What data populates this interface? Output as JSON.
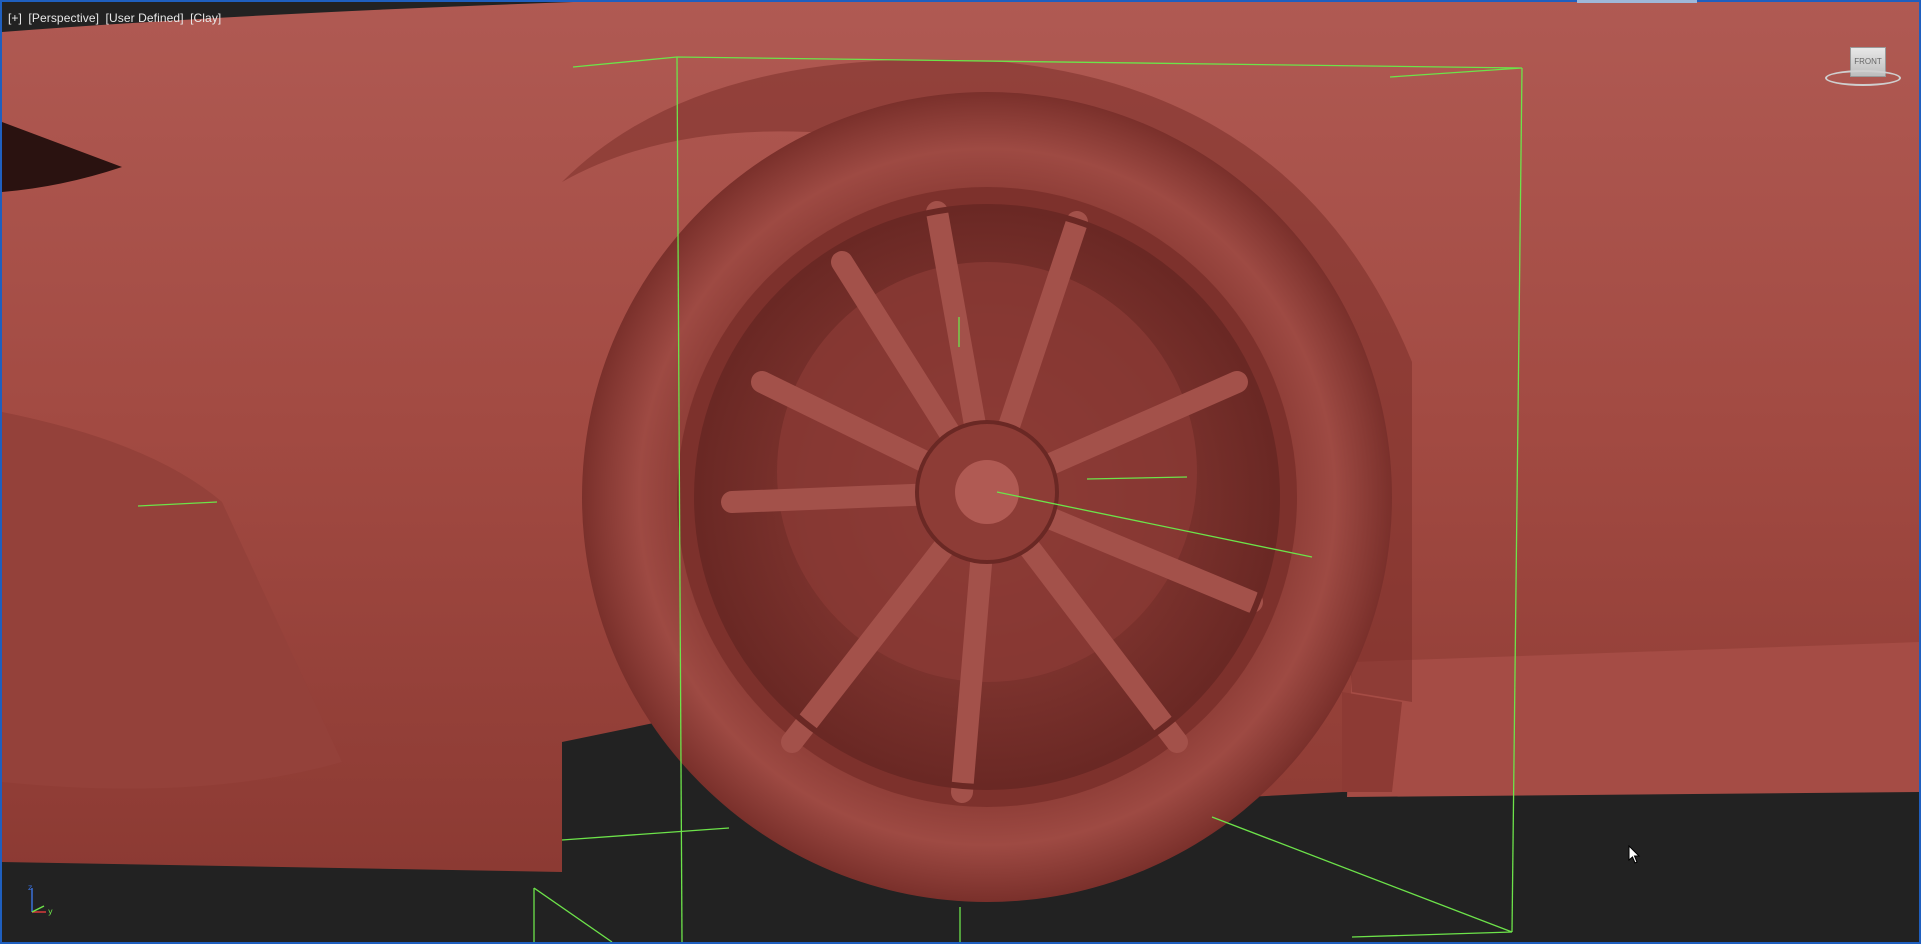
{
  "viewport": {
    "labels": [
      "[+]",
      "[Perspective]",
      "[User Defined]",
      "[Clay]"
    ],
    "mode": "Perspective",
    "shading": "Clay"
  },
  "viewcube": {
    "face": "FRONT"
  },
  "axis": {
    "x": "x",
    "y": "y",
    "z": "z"
  },
  "colors": {
    "clay": "#a24a42",
    "clay_dark": "#6e2a26",
    "clay_light": "#b4605a",
    "gizmo": "#6de34a",
    "background": "#222222",
    "viewport_border": "#1f5fbf"
  }
}
